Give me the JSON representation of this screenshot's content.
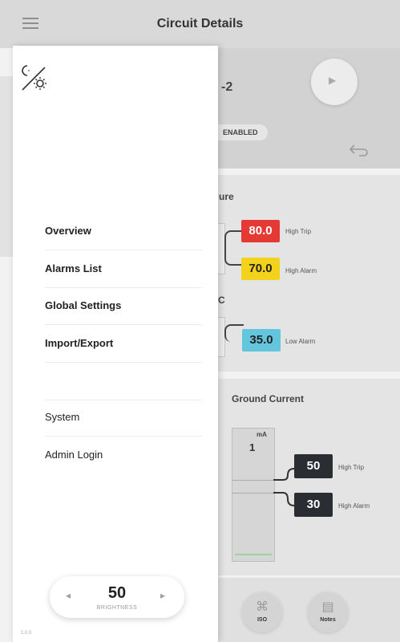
{
  "header": {
    "title": "Circuit Details",
    "menu_icon": "hamburger-icon"
  },
  "circuit": {
    "name_fragment": "-2",
    "status": "ENABLED"
  },
  "temperature": {
    "label_fragment": "ure",
    "setpoints": [
      {
        "value": "80.0",
        "label": "High Trip",
        "color": "#e53935"
      },
      {
        "value": "70.0",
        "label": "High Alarm",
        "color": "#f2d21b"
      },
      {
        "value": "35.0",
        "label": "Low Alarm",
        "color": "#63c6dc"
      }
    ],
    "section_fragment": "C"
  },
  "ground_current": {
    "title": "Ground Current",
    "unit": "mA",
    "value": "1",
    "setpoints": [
      {
        "value": "50",
        "label": "High Trip"
      },
      {
        "value": "30",
        "label": "High Alarm"
      }
    ]
  },
  "bottom_buttons": [
    {
      "label": "ISO",
      "icon": "iso-icon"
    },
    {
      "label": "Notes",
      "icon": "notes-icon"
    }
  ],
  "drawer": {
    "theme_icon": "day-night-toggle-icon",
    "menu_items": [
      {
        "label": "Overview",
        "bold": true
      },
      {
        "label": "Alarms List",
        "bold": true
      },
      {
        "label": "Global Settings",
        "bold": true
      },
      {
        "label": "Import/Export",
        "bold": true
      },
      {
        "label": "System",
        "bold": false
      },
      {
        "label": "Admin Login",
        "bold": false
      }
    ],
    "brightness": {
      "value": "50",
      "label": "BRIGHTNESS"
    },
    "version": "1.0.0"
  },
  "colors": {
    "high_trip": "#e53935",
    "high_alarm": "#f2d21b",
    "low_alarm": "#63c6dc",
    "dark_box": "#2a2e33"
  }
}
